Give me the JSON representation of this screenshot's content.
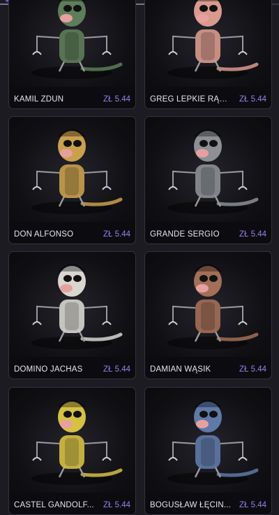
{
  "products": [
    {
      "name": "KAMIL ZDUN",
      "price": "ZŁ 5.44",
      "figure_icon": "figure-glasses-green",
      "color": "#5e7d5a"
    },
    {
      "name": "GREG LEPKIE RĄCZ...",
      "price": "ZŁ 5.44",
      "figure_icon": "figure-cowboy-pink",
      "color": "#d99a8d"
    },
    {
      "name": "DON ALFONSO",
      "price": "ZŁ 5.44",
      "figure_icon": "figure-wheelchair-blond",
      "color": "#c9a04e"
    },
    {
      "name": "GRANDE SERGIO",
      "price": "ZŁ 5.44",
      "figure_icon": "figure-grey-suit",
      "color": "#8c8f94"
    },
    {
      "name": "DOMINO JACHAŚ",
      "price": "ZŁ 5.44",
      "figure_icon": "figure-chef-white",
      "color": "#d8d6cf"
    },
    {
      "name": "DAMIAN WĄSIK",
      "price": "ZŁ 5.44",
      "figure_icon": "figure-brown-blue",
      "color": "#a36f58"
    },
    {
      "name": "CASTEL GANDOLF...",
      "price": "ZŁ 5.44",
      "figure_icon": "figure-yellow-black",
      "color": "#d6c045"
    },
    {
      "name": "BOGUSŁAW ŁĘCIN...",
      "price": "ZŁ 5.44",
      "figure_icon": "figure-blue-grey",
      "color": "#5f79a8"
    }
  ]
}
